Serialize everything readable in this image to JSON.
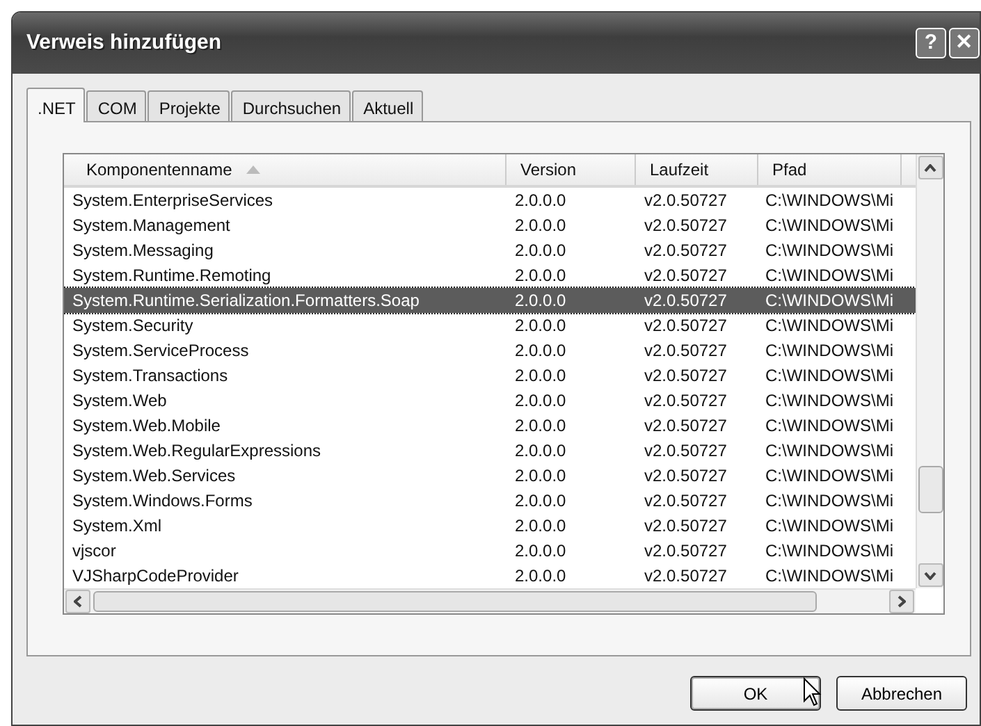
{
  "window": {
    "title": "Verweis hinzufügen",
    "help_button": "?",
    "close_button": "✕"
  },
  "tabs": [
    {
      "label": ".NET",
      "selected": true
    },
    {
      "label": "COM",
      "selected": false
    },
    {
      "label": "Projekte",
      "selected": false
    },
    {
      "label": "Durchsuchen",
      "selected": false
    },
    {
      "label": "Aktuell",
      "selected": false
    }
  ],
  "table": {
    "columns": [
      {
        "label": "Komponentenname",
        "sorted": true
      },
      {
        "label": "Version",
        "sorted": false
      },
      {
        "label": "Laufzeit",
        "sorted": false
      },
      {
        "label": "Pfad",
        "sorted": false
      }
    ],
    "rows": [
      {
        "cells": [
          "System.EnterpriseServices",
          "2.0.0.0",
          "v2.0.50727",
          "C:\\WINDOWS\\Mi"
        ],
        "selected": false
      },
      {
        "cells": [
          "System.Management",
          "2.0.0.0",
          "v2.0.50727",
          "C:\\WINDOWS\\Mi"
        ],
        "selected": false
      },
      {
        "cells": [
          "System.Messaging",
          "2.0.0.0",
          "v2.0.50727",
          "C:\\WINDOWS\\Mi"
        ],
        "selected": false
      },
      {
        "cells": [
          "System.Runtime.Remoting",
          "2.0.0.0",
          "v2.0.50727",
          "C:\\WINDOWS\\Mi"
        ],
        "selected": false
      },
      {
        "cells": [
          "System.Runtime.Serialization.Formatters.Soap",
          "2.0.0.0",
          "v2.0.50727",
          "C:\\WINDOWS\\Mi"
        ],
        "selected": true
      },
      {
        "cells": [
          "System.Security",
          "2.0.0.0",
          "v2.0.50727",
          "C:\\WINDOWS\\Mi"
        ],
        "selected": false
      },
      {
        "cells": [
          "System.ServiceProcess",
          "2.0.0.0",
          "v2.0.50727",
          "C:\\WINDOWS\\Mi"
        ],
        "selected": false
      },
      {
        "cells": [
          "System.Transactions",
          "2.0.0.0",
          "v2.0.50727",
          "C:\\WINDOWS\\Mi"
        ],
        "selected": false
      },
      {
        "cells": [
          "System.Web",
          "2.0.0.0",
          "v2.0.50727",
          "C:\\WINDOWS\\Mi"
        ],
        "selected": false
      },
      {
        "cells": [
          "System.Web.Mobile",
          "2.0.0.0",
          "v2.0.50727",
          "C:\\WINDOWS\\Mi"
        ],
        "selected": false
      },
      {
        "cells": [
          "System.Web.RegularExpressions",
          "2.0.0.0",
          "v2.0.50727",
          "C:\\WINDOWS\\Mi"
        ],
        "selected": false
      },
      {
        "cells": [
          "System.Web.Services",
          "2.0.0.0",
          "v2.0.50727",
          "C:\\WINDOWS\\Mi"
        ],
        "selected": false
      },
      {
        "cells": [
          "System.Windows.Forms",
          "2.0.0.0",
          "v2.0.50727",
          "C:\\WINDOWS\\Mi"
        ],
        "selected": false
      },
      {
        "cells": [
          "System.Xml",
          "2.0.0.0",
          "v2.0.50727",
          "C:\\WINDOWS\\Mi"
        ],
        "selected": false
      },
      {
        "cells": [
          "vjscor",
          "2.0.0.0",
          "v2.0.50727",
          "C:\\WINDOWS\\Mi"
        ],
        "selected": false
      },
      {
        "cells": [
          "VJSharpCodeProvider",
          "2.0.0.0",
          "v2.0.50727",
          "C:\\WINDOWS\\Mi"
        ],
        "selected": false
      }
    ]
  },
  "buttons": [
    {
      "label": "OK",
      "default": true
    },
    {
      "label": "Abbrechen",
      "default": false
    }
  ]
}
